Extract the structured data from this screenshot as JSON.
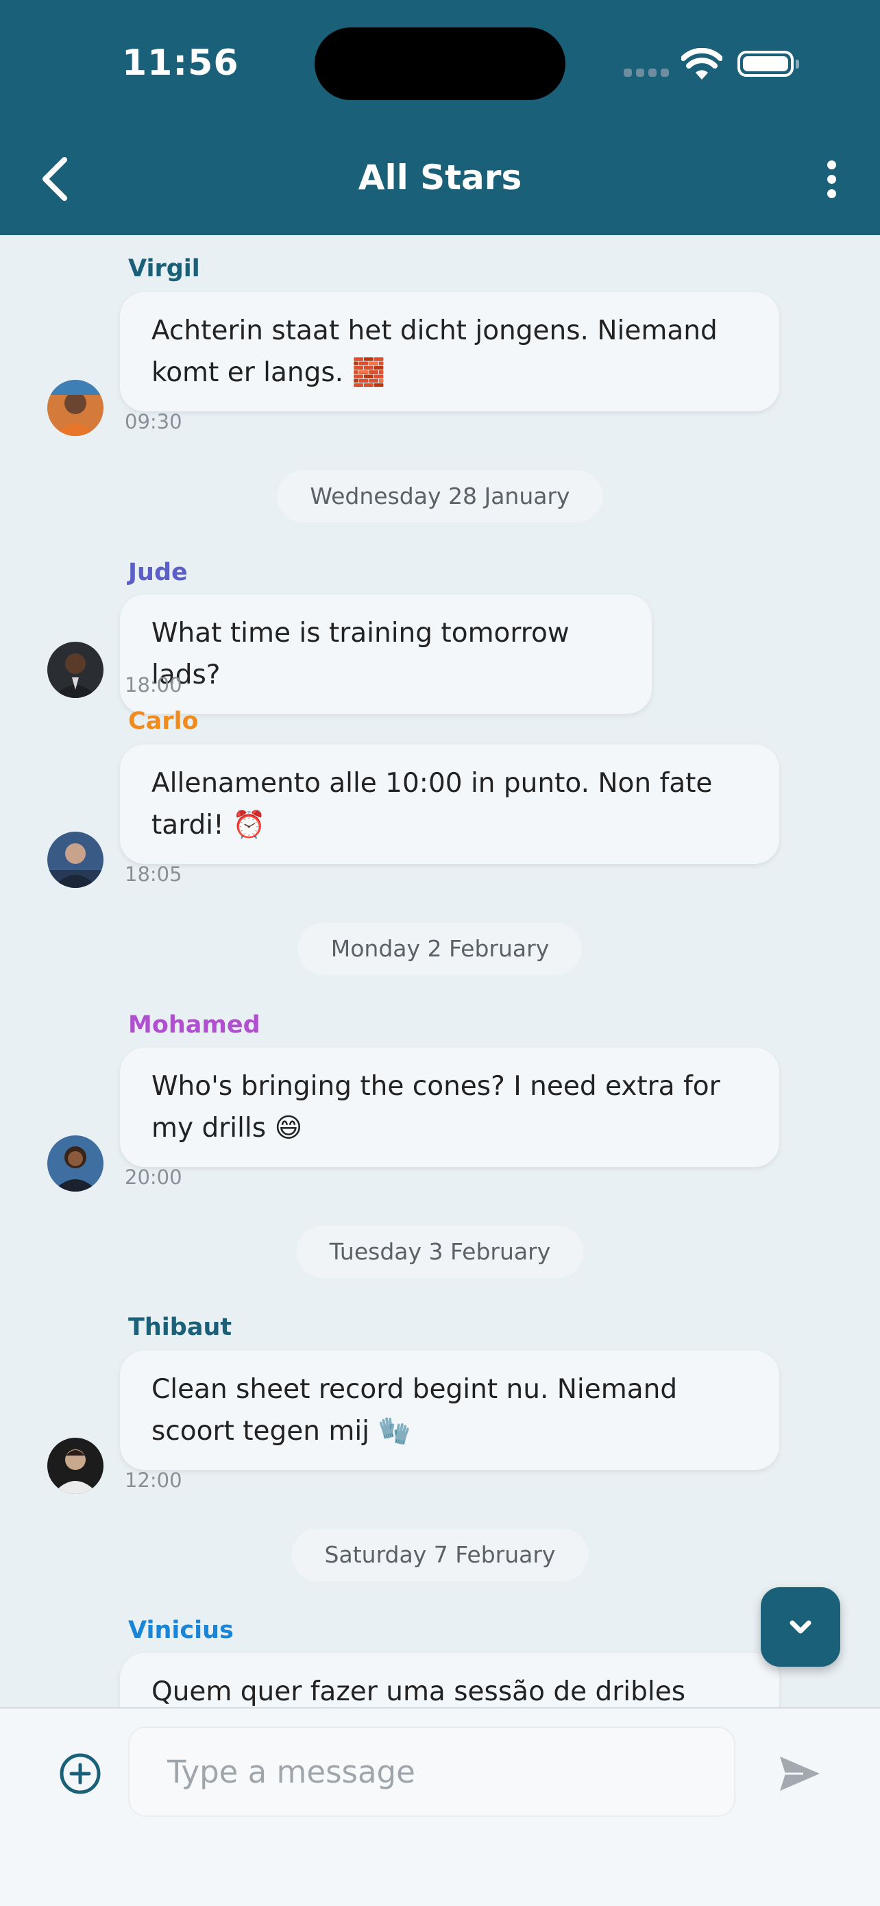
{
  "status_bar": {
    "time": "11:56"
  },
  "header": {
    "title": "All Stars"
  },
  "messages": [
    {
      "sender": "Virgil",
      "text": "Achterin staat het dicht jongens. Niemand komt er langs. 🧱",
      "time": "09:30",
      "color": "#1b6079"
    },
    {
      "sender": "Jude",
      "text": "What time is training tomorrow lads?",
      "time": "18:00",
      "color": "#5b5fc7"
    },
    {
      "sender": "Carlo",
      "text": "Allenamento alle 10:00 in punto. Non fate tardi! ⏰",
      "time": "18:05",
      "color": "#f08c1e"
    },
    {
      "sender": "Mohamed",
      "text": "Who's bringing the cones? I need extra for my drills 😄",
      "time": "20:00",
      "color": "#b04fd0"
    },
    {
      "sender": "Thibaut",
      "text": "Clean sheet record begint nu. Niemand scoort tegen mij 🧤",
      "time": "12:00",
      "color": "#1b6079"
    },
    {
      "sender": "Vinicius",
      "text": "Quem quer fazer uma sessão de dribles depois",
      "color": "#1a85d6"
    }
  ],
  "date_separators": [
    "Wednesday 28 January",
    "Monday 2 February",
    "Tuesday 3 February",
    "Saturday 7 February"
  ],
  "composer": {
    "placeholder": "Type a message"
  },
  "icons": {
    "back": "chevron-left-icon",
    "more": "more-vertical-icon",
    "scroll_down": "chevron-down-icon",
    "attach": "plus-circle-icon",
    "send": "send-icon"
  },
  "colors": {
    "header_bg": "#1b6079",
    "chat_bg": "#e9f0f4",
    "bubble_bg": "#f4f7fa"
  }
}
